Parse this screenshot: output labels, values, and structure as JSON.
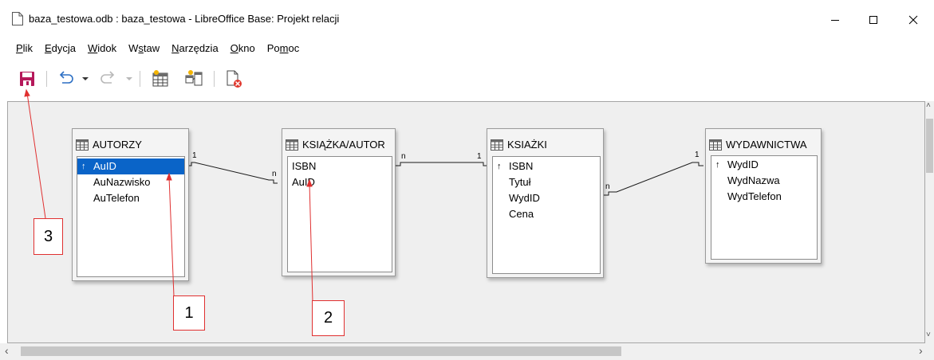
{
  "window": {
    "title": "baza_testowa.odb : baza_testowa - LibreOffice Base: Projekt relacji",
    "controls": [
      "minimize-icon",
      "maximize-icon",
      "close-icon"
    ]
  },
  "menu": {
    "items": [
      {
        "pre": "",
        "mn": "P",
        "post": "lik"
      },
      {
        "pre": "",
        "mn": "E",
        "post": "dycja"
      },
      {
        "pre": "",
        "mn": "W",
        "post": "idok"
      },
      {
        "pre": "W",
        "mn": "s",
        "post": "taw"
      },
      {
        "pre": "",
        "mn": "N",
        "post": "arzędzia"
      },
      {
        "pre": "",
        "mn": "O",
        "post": "kno"
      },
      {
        "pre": "Po",
        "mn": "m",
        "post": "oc"
      }
    ]
  },
  "toolbar": {
    "buttons": [
      "save-icon",
      "undo-icon",
      "undo-dropdown-icon",
      "redo-icon",
      "redo-dropdown-icon",
      "add-tables-icon",
      "new-relation-icon",
      "delete-icon"
    ]
  },
  "tables": [
    {
      "name": "AUTORZY",
      "fields": [
        {
          "label": "AuID",
          "key": true,
          "selected": true
        },
        {
          "label": "AuNazwisko",
          "key": false,
          "selected": false
        },
        {
          "label": "AuTelefon",
          "key": false,
          "selected": false
        }
      ]
    },
    {
      "name": "KSIĄŻKA/AUTOR",
      "fields": [
        {
          "label": "ISBN",
          "key": false,
          "selected": false
        },
        {
          "label": "AuID",
          "key": false,
          "selected": false
        }
      ]
    },
    {
      "name": "KSIAŻKI",
      "fields": [
        {
          "label": "ISBN",
          "key": true,
          "selected": false
        },
        {
          "label": "Tytuł",
          "key": false,
          "selected": false
        },
        {
          "label": "WydID",
          "key": false,
          "selected": false
        },
        {
          "label": "Cena",
          "key": false,
          "selected": false
        }
      ]
    },
    {
      "name": "WYDAWNICTWA",
      "fields": [
        {
          "label": "WydID",
          "key": true,
          "selected": false
        },
        {
          "label": "WydNazwa",
          "key": false,
          "selected": false
        },
        {
          "label": "WydTelefon",
          "key": false,
          "selected": false
        }
      ]
    }
  ],
  "relations": [
    {
      "from": "AUTORZY",
      "to": "KSIĄŻKA/AUTOR",
      "from_card": "1",
      "to_card": "n"
    },
    {
      "from": "KSIĄŻKA/AUTOR",
      "to": "KSIAŻKI",
      "from_card": "n",
      "to_card": "1"
    },
    {
      "from": "KSIAŻKI",
      "to": "WYDAWNICTWA",
      "from_card": "n",
      "to_card": "1"
    }
  ],
  "annotations": [
    "1",
    "2",
    "3"
  ],
  "colors": {
    "accent": "#0a64c8",
    "annotation": "#e03030",
    "canvas": "#efefef"
  }
}
